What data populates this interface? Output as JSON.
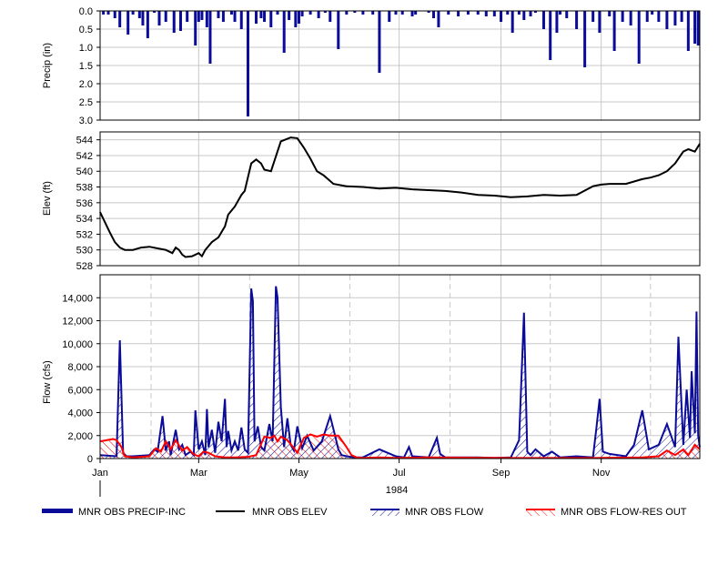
{
  "chart_data": [
    {
      "type": "bar",
      "ylabel": "Precip (in)",
      "yticks": [
        "0.0",
        "0.5",
        "1.0",
        "1.5",
        "2.0",
        "2.5",
        "3.0"
      ],
      "ylim": [
        3.0,
        0.0
      ],
      "inverted": true,
      "grid": true,
      "series": [
        {
          "name": "MNR OBS PRECIP-INC",
          "color": "#0b0b99",
          "x_day": [
            2,
            5,
            9,
            12,
            17,
            20,
            24,
            26,
            29,
            33,
            36,
            40,
            45,
            49,
            53,
            58,
            60,
            62,
            65,
            67,
            72,
            75,
            80,
            82,
            86,
            90,
            95,
            98,
            100,
            104,
            108,
            112,
            115,
            119,
            121,
            123,
            128,
            133,
            137,
            140,
            145,
            150,
            155,
            160,
            166,
            170,
            176,
            180,
            184,
            190,
            192,
            200,
            203,
            206,
            212,
            218,
            224,
            230,
            235,
            240,
            244,
            248,
            251,
            255,
            258,
            262,
            265,
            270,
            274,
            278,
            280,
            284,
            290,
            295,
            300,
            304,
            310,
            313,
            318,
            323,
            328,
            333,
            336,
            340,
            345,
            350,
            354,
            358,
            362,
            364
          ],
          "values": [
            0.1,
            0.1,
            0.2,
            0.45,
            0.65,
            0.1,
            0.2,
            0.4,
            0.75,
            0.05,
            0.4,
            0.3,
            0.6,
            0.55,
            0.3,
            0.95,
            0.3,
            0.25,
            0.45,
            1.45,
            0.2,
            0.3,
            0.1,
            0.3,
            0.5,
            2.9,
            0.35,
            0.2,
            0.3,
            0.45,
            0.1,
            1.15,
            0.25,
            0.45,
            0.35,
            0.15,
            0.1,
            0.2,
            0.05,
            0.3,
            1.05,
            0.1,
            0.05,
            0.1,
            0.1,
            1.7,
            0.3,
            0.1,
            0.1,
            0.15,
            0.1,
            0.05,
            0.2,
            0.45,
            0.1,
            0.15,
            0.1,
            0.1,
            0.15,
            0.15,
            0.3,
            0.1,
            0.6,
            0.1,
            0.25,
            0.15,
            0.05,
            0.5,
            1.35,
            0.6,
            0.1,
            0.2,
            0.5,
            1.55,
            0.3,
            0.6,
            0.15,
            1.1,
            0.3,
            0.4,
            1.45,
            0.3,
            0.1,
            0.3,
            0.5,
            0.4,
            0.3,
            1.1,
            0.9,
            0.95
          ]
        }
      ]
    },
    {
      "type": "line",
      "ylabel": "Elev (ft)",
      "yticks": [
        "528",
        "530",
        "532",
        "534",
        "536",
        "538",
        "540",
        "542",
        "544"
      ],
      "ylim": [
        528,
        545
      ],
      "grid": true,
      "series": [
        {
          "name": "MNR OBS ELEV",
          "color": "#000000",
          "x_day": [
            0,
            3,
            6,
            9,
            12,
            15,
            20,
            25,
            30,
            35,
            40,
            44,
            46,
            48,
            50,
            52,
            56,
            60,
            62,
            64,
            68,
            72,
            76,
            78,
            82,
            86,
            88,
            92,
            95,
            98,
            100,
            104,
            110,
            116,
            120,
            124,
            128,
            132,
            136,
            142,
            150,
            160,
            170,
            180,
            190,
            200,
            210,
            220,
            230,
            240,
            250,
            260,
            270,
            280,
            290,
            300,
            305,
            310,
            320,
            330,
            335,
            340,
            345,
            350,
            355,
            358,
            362,
            365
          ],
          "values": [
            534.8,
            533.5,
            532.2,
            531.0,
            530.3,
            530.0,
            530.0,
            530.3,
            530.4,
            530.2,
            530.0,
            529.6,
            530.3,
            530.0,
            529.4,
            529.1,
            529.2,
            529.6,
            529.2,
            530.0,
            531.0,
            531.6,
            533.0,
            534.5,
            535.5,
            537.0,
            537.5,
            541.0,
            541.5,
            541.0,
            540.2,
            540.0,
            543.8,
            544.3,
            544.2,
            543.0,
            541.6,
            540.0,
            539.5,
            538.4,
            538.1,
            538.0,
            537.8,
            537.9,
            537.7,
            537.6,
            537.5,
            537.3,
            537.0,
            536.9,
            536.7,
            536.8,
            537.0,
            536.9,
            537.0,
            538.1,
            538.3,
            538.4,
            538.4,
            539.0,
            539.2,
            539.5,
            540.0,
            541.0,
            542.5,
            542.8,
            542.5,
            543.5
          ]
        }
      ]
    },
    {
      "type": "line",
      "ylabel": "Flow (cfs)",
      "yticks": [
        "0",
        "2,000",
        "4,000",
        "6,000",
        "8,000",
        "10,000",
        "12,000",
        "14,000"
      ],
      "ylim": [
        0,
        16000
      ],
      "grid": true,
      "xticks": [
        "Jan",
        "Mar",
        "May",
        "Jul",
        "Sep",
        "Nov"
      ],
      "x_tick_days": [
        0,
        60,
        121,
        182,
        244,
        305
      ],
      "xlabel_year": "1984",
      "series": [
        {
          "name": "MNR OBS FLOW",
          "color": "#0b0b99",
          "x_day": [
            0,
            10,
            12,
            14,
            16,
            20,
            30,
            33,
            35,
            38,
            40,
            42,
            43,
            46,
            48,
            50,
            52,
            55,
            57,
            58,
            60,
            62,
            64,
            65,
            66,
            68,
            70,
            72,
            74,
            76,
            77,
            78,
            80,
            82,
            84,
            86,
            88,
            90,
            92,
            93,
            94,
            96,
            98,
            100,
            103,
            105,
            107,
            108,
            110,
            112,
            114,
            116,
            118,
            120,
            123,
            126,
            130,
            135,
            140,
            143,
            145,
            147,
            150,
            155,
            160,
            170,
            180,
            185,
            188,
            190,
            200,
            205,
            207,
            210,
            220,
            230,
            240,
            250,
            255,
            258,
            260,
            262,
            265,
            270,
            275,
            280,
            290,
            300,
            302,
            304,
            306,
            310,
            320,
            325,
            330,
            332,
            334,
            340,
            345,
            350,
            352,
            355,
            357,
            359,
            360,
            362,
            363,
            364,
            365
          ],
          "values": [
            300,
            200,
            10300,
            500,
            200,
            200,
            300,
            800,
            600,
            3700,
            700,
            1500,
            300,
            2500,
            800,
            1200,
            300,
            600,
            300,
            4200,
            800,
            1500,
            300,
            4300,
            1000,
            2500,
            500,
            3200,
            1500,
            5200,
            1000,
            2400,
            700,
            1500,
            700,
            2700,
            800,
            500,
            14800,
            13700,
            1500,
            2800,
            1000,
            700,
            3000,
            1500,
            15000,
            14000,
            4500,
            1000,
            3500,
            1200,
            700,
            2800,
            900,
            2000,
            700,
            1500,
            3700,
            2000,
            800,
            300,
            200,
            100,
            100,
            800,
            200,
            100,
            1000,
            200,
            100,
            1800,
            400,
            100,
            100,
            100,
            50,
            100,
            1600,
            12700,
            600,
            300,
            800,
            200,
            600,
            100,
            200,
            100,
            2600,
            5200,
            600,
            400,
            200,
            1200,
            4200,
            2500,
            800,
            1200,
            3000,
            1000,
            10600,
            1200,
            6000,
            1800,
            7600,
            2200,
            12800,
            2000,
            1000
          ]
        },
        {
          "name": "MNR OBS FLOW-RES OUT",
          "color": "#ff0000",
          "x_day": [
            0,
            8,
            10,
            13,
            15,
            20,
            30,
            34,
            37,
            40,
            43,
            46,
            50,
            53,
            56,
            58,
            60,
            63,
            66,
            70,
            76,
            82,
            90,
            95,
            100,
            104,
            106,
            108,
            110,
            114,
            118,
            120,
            124,
            128,
            132,
            136,
            140,
            145,
            150,
            153,
            156,
            160,
            170,
            180,
            200,
            250,
            300,
            330,
            340,
            345,
            350,
            355,
            358,
            362,
            365
          ],
          "values": [
            1500,
            1700,
            1600,
            1000,
            200,
            100,
            200,
            900,
            600,
            1500,
            800,
            1600,
            700,
            1000,
            500,
            300,
            200,
            600,
            500,
            200,
            100,
            100,
            150,
            300,
            1900,
            1800,
            2000,
            1500,
            1900,
            1600,
            900,
            500,
            1800,
            2100,
            1900,
            2100,
            2000,
            2000,
            1000,
            300,
            100,
            50,
            100,
            50,
            100,
            50,
            50,
            100,
            200,
            700,
            300,
            800,
            300,
            1200,
            800
          ]
        }
      ]
    }
  ],
  "legend": [
    {
      "label": "MNR OBS PRECIP-INC",
      "color": "#0b0b99",
      "style": "thick"
    },
    {
      "label": "MNR OBS ELEV",
      "color": "#000000",
      "style": "line"
    },
    {
      "label": "MNR OBS FLOW",
      "color": "#0b0b99",
      "style": "hatch"
    },
    {
      "label": "MNR OBS FLOW-RES OUT",
      "color": "#ff0000",
      "style": "hatch"
    }
  ]
}
